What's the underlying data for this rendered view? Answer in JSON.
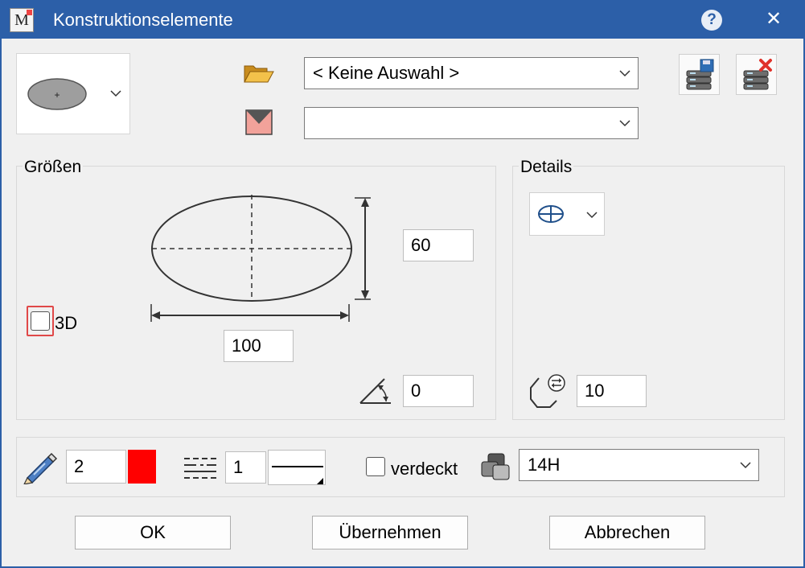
{
  "window": {
    "title": "Konstruktionselemente",
    "logo_letter": "M",
    "help_label": "?",
    "close_label": "✕"
  },
  "top": {
    "shape_selector_icon": "ellipse-icon",
    "folder_combo": {
      "value": "< Keine Auswahl >"
    },
    "style_combo": {
      "value": ""
    },
    "save_icon": "database-save-icon",
    "delete_icon": "database-delete-icon"
  },
  "sizes": {
    "label": "Größen",
    "height": "60",
    "width": "100",
    "angle": "0",
    "threed_label": "3D",
    "threed_checked": false
  },
  "details": {
    "label": "Details",
    "segments": "10"
  },
  "pen": {
    "thickness": "2",
    "color": "#ff0000",
    "linetype": "1",
    "hidden_label": "verdeckt",
    "hidden_checked": false,
    "layer": "14H"
  },
  "buttons": {
    "ok": "OK",
    "apply": "Übernehmen",
    "cancel": "Abbrechen"
  },
  "colors": {
    "titlebar": "#2c5fa8",
    "highlight": "#e04848"
  }
}
